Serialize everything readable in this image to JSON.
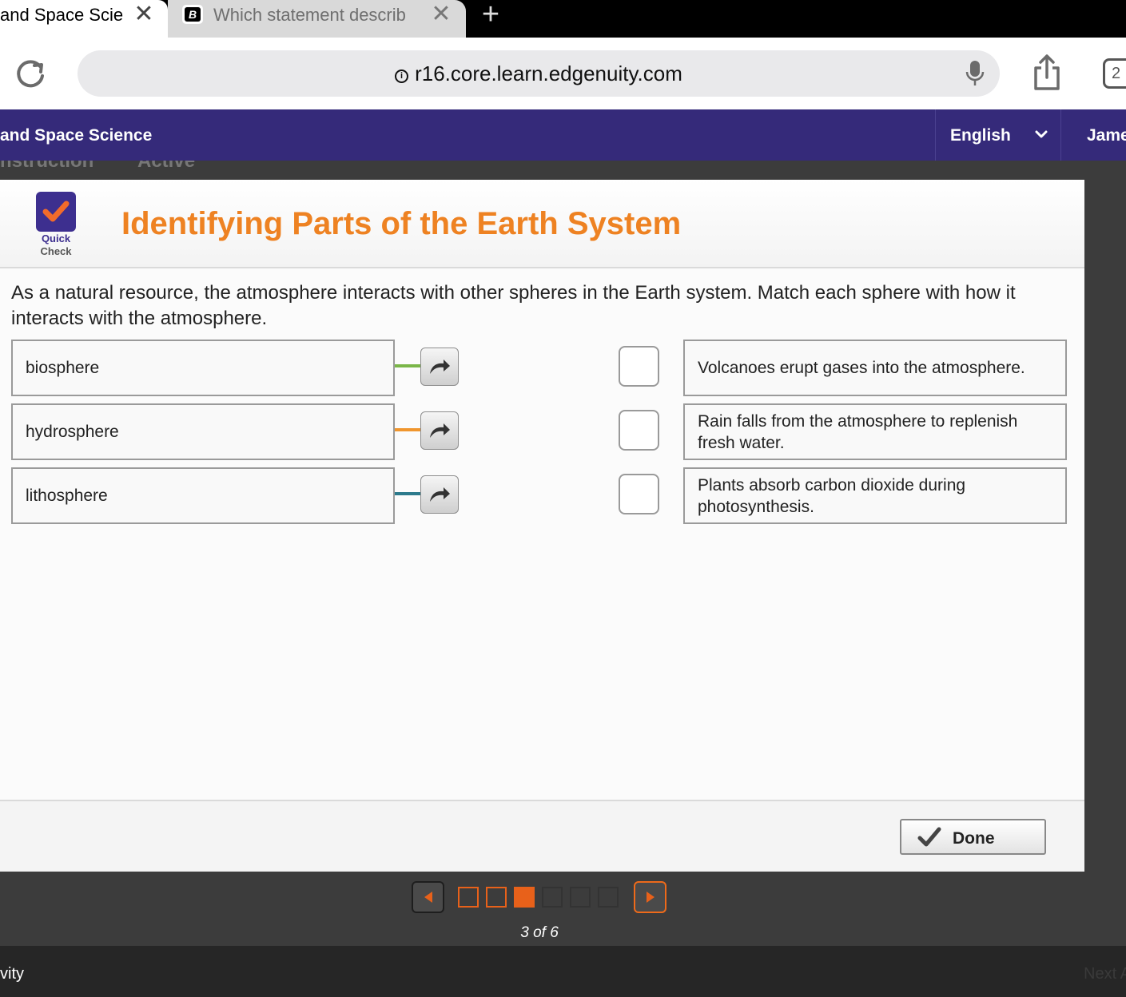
{
  "browser": {
    "tabs": [
      {
        "title": "and Space Scie",
        "active": true
      },
      {
        "title": "Which statement describ",
        "active": false,
        "favicon_letter": "B"
      }
    ],
    "close_glyph": "✕",
    "new_tab_glyph": "+",
    "url": "r16.core.learn.edgenuity.com",
    "info_glyph": "i",
    "tab_count": "2"
  },
  "header": {
    "course_title": "and Space Science",
    "language": "English",
    "user": "Jame"
  },
  "breadcrumb": {
    "left": "nstruction",
    "right": "Active"
  },
  "activity": {
    "badge_label_line1": "Quick",
    "badge_label_line2": "Check",
    "title": "Identifying Parts of the Earth System",
    "prompt": "As a natural resource, the atmosphere interacts with other spheres in the Earth system. Match each sphere with how it interacts with the atmosphere.",
    "left_items": [
      {
        "label": "biosphere",
        "color": "#7ab648"
      },
      {
        "label": "hydrosphere",
        "color": "#f0962e"
      },
      {
        "label": "lithosphere",
        "color": "#2c7a8c"
      }
    ],
    "right_items": [
      {
        "label": "Volcanoes erupt gases into the atmosphere."
      },
      {
        "label": "Rain falls from the atmosphere to replenish fresh water."
      },
      {
        "label": "Plants absorb carbon dioxide during photosynthesis."
      }
    ],
    "done_label": "Done"
  },
  "pager": {
    "current": 3,
    "total": 6,
    "label": "3 of 6",
    "accent": "#e8611a"
  },
  "footer": {
    "prev_activity": "vity",
    "next_activity": "Next A"
  }
}
